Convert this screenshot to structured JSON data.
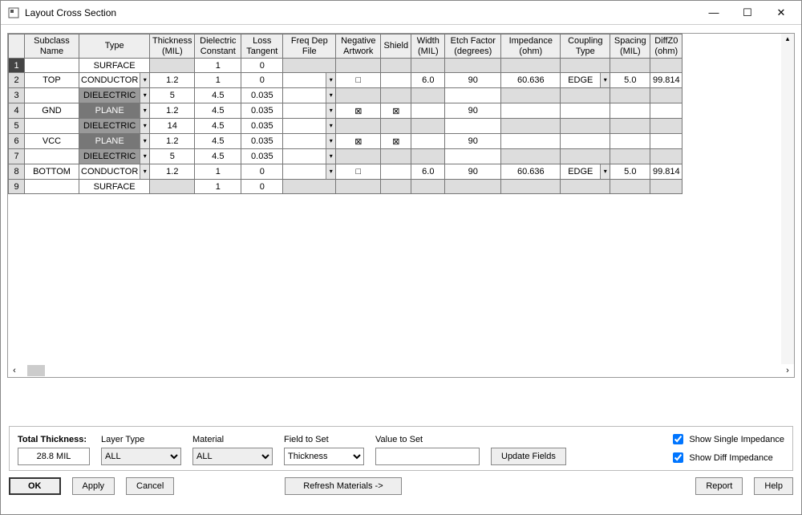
{
  "title": "Layout Cross Section",
  "columns": [
    "",
    "Subclass\nName",
    "Type",
    "Thickness\n(MIL)",
    "Dielectric\nConstant",
    "Loss\nTangent",
    "Freq Dep\nFile",
    "Negative\nArtwork",
    "Shield",
    "Width\n(MIL)",
    "Etch Factor\n(degrees)",
    "Impedance\n(ohm)",
    "Coupling\nType",
    "Spacing\n(MIL)",
    "DiffZ0\n(ohm)"
  ],
  "rows": [
    {
      "n": "1",
      "name": "",
      "type": "SURFACE",
      "dd": false,
      "thk": "",
      "dc": "1",
      "lt": "0",
      "fdp": "",
      "na": "",
      "sh": "",
      "w": "",
      "ef": "",
      "imp": "",
      "ct": "",
      "ctdd": false,
      "sp": "",
      "dz": "",
      "gray": true
    },
    {
      "n": "2",
      "name": "TOP",
      "type": "CONDUCTOR",
      "dd": true,
      "thk": "1.2",
      "dc": "1",
      "lt": "0",
      "fdp": "",
      "fdd": true,
      "na": "□",
      "sh": "",
      "w": "6.0",
      "ef": "90",
      "imp": "60.636",
      "ct": "EDGE",
      "ctdd": true,
      "sp": "5.0",
      "dz": "99.814"
    },
    {
      "n": "3",
      "name": "",
      "type": "DIELECTRIC",
      "diel": true,
      "dd": true,
      "thk": "5",
      "dc": "4.5",
      "lt": "0.035",
      "fdp": "",
      "fdd": true,
      "na": "",
      "sh": "",
      "w": "",
      "ef": "",
      "imp": "",
      "ct": "",
      "sp": "",
      "dz": "",
      "gray2": true
    },
    {
      "n": "4",
      "name": "GND",
      "type": "PLANE",
      "plane": true,
      "dd": true,
      "thk": "1.2",
      "dc": "4.5",
      "lt": "0.035",
      "fdp": "",
      "fdd": true,
      "na": "⊠",
      "sh": "⊠",
      "w": "",
      "ef": "90",
      "imp": "",
      "ct": "",
      "sp": "",
      "dz": ""
    },
    {
      "n": "5",
      "name": "",
      "type": "DIELECTRIC",
      "diel": true,
      "dd": true,
      "thk": "14",
      "dc": "4.5",
      "lt": "0.035",
      "fdp": "",
      "fdd": true,
      "na": "",
      "sh": "",
      "w": "",
      "ef": "",
      "imp": "",
      "ct": "",
      "sp": "",
      "dz": "",
      "gray2": true
    },
    {
      "n": "6",
      "name": "VCC",
      "type": "PLANE",
      "plane": true,
      "dd": true,
      "thk": "1.2",
      "dc": "4.5",
      "lt": "0.035",
      "fdp": "",
      "fdd": true,
      "na": "⊠",
      "sh": "⊠",
      "w": "",
      "ef": "90",
      "imp": "",
      "ct": "",
      "sp": "",
      "dz": ""
    },
    {
      "n": "7",
      "name": "",
      "type": "DIELECTRIC",
      "diel": true,
      "dd": true,
      "thk": "5",
      "dc": "4.5",
      "lt": "0.035",
      "fdp": "",
      "fdd": true,
      "na": "",
      "sh": "",
      "w": "",
      "ef": "",
      "imp": "",
      "ct": "",
      "sp": "",
      "dz": "",
      "gray2": true
    },
    {
      "n": "8",
      "name": "BOTTOM",
      "type": "CONDUCTOR",
      "dd": true,
      "thk": "1.2",
      "dc": "1",
      "lt": "0",
      "fdp": "",
      "fdd": true,
      "na": "□",
      "sh": "",
      "w": "6.0",
      "ef": "90",
      "imp": "60.636",
      "ct": "EDGE",
      "ctdd": true,
      "sp": "5.0",
      "dz": "99.814"
    },
    {
      "n": "9",
      "name": "",
      "type": "SURFACE",
      "dd": false,
      "thk": "",
      "dc": "1",
      "lt": "0",
      "fdp": "",
      "na": "",
      "sh": "",
      "w": "",
      "ef": "",
      "imp": "",
      "ct": "",
      "ctdd": false,
      "sp": "",
      "dz": "",
      "gray": true
    }
  ],
  "bottom": {
    "total_thickness_label": "Total Thickness:",
    "total_thickness": "28.8 MIL",
    "layer_type_label": "Layer Type",
    "layer_type": "ALL",
    "material_label": "Material",
    "material": "ALL",
    "field_label": "Field to Set",
    "field": "Thickness",
    "value_label": "Value to Set",
    "value": "",
    "update": "Update Fields",
    "show_single": "Show Single Impedance",
    "show_diff": "Show Diff Impedance"
  },
  "buttons": {
    "ok": "OK",
    "apply": "Apply",
    "cancel": "Cancel",
    "refresh": "Refresh Materials ->",
    "report": "Report",
    "help": "Help"
  }
}
